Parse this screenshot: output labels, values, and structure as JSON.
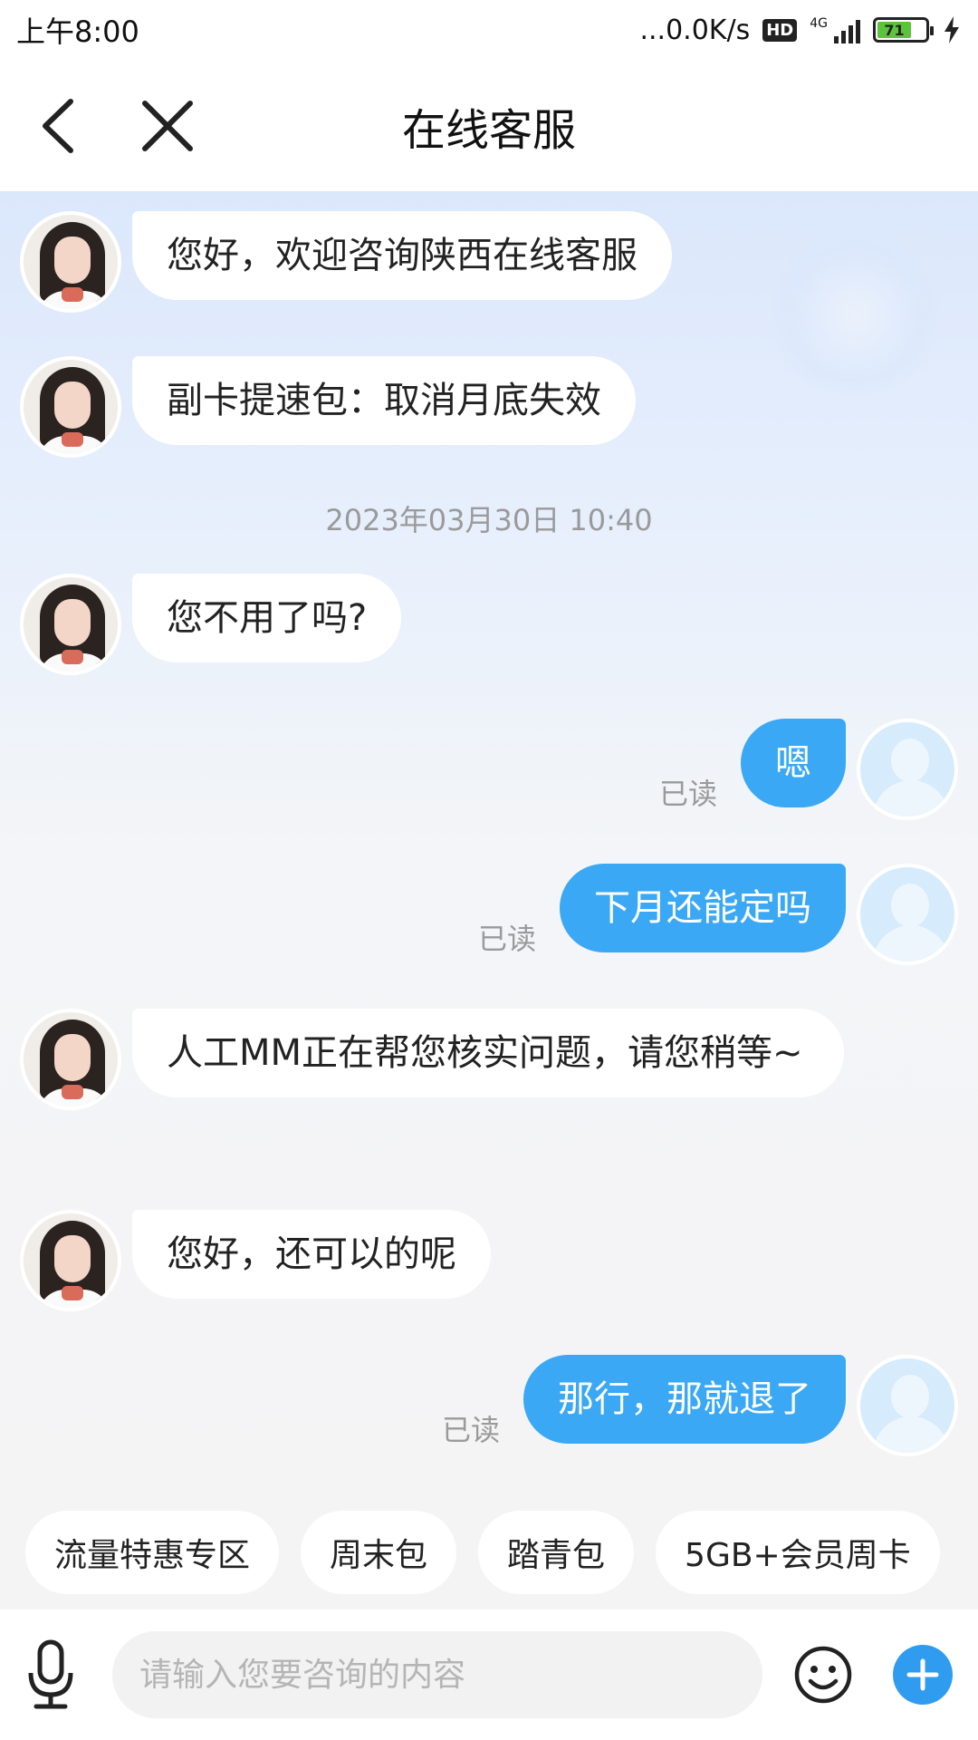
{
  "status_bar": {
    "time": "上午8:00",
    "net_speed": "...0.0K/s",
    "hd": "HD",
    "network": "4G",
    "battery": "71"
  },
  "nav": {
    "back_icon": "chevron-left-icon",
    "close_icon": "close-icon",
    "title": "在线客服"
  },
  "messages": [
    {
      "from": "agent",
      "text": "您好，欢迎咨询陕西在线客服"
    },
    {
      "from": "agent",
      "text": "副卡提速包：取消月底失效"
    },
    {
      "from": "agent",
      "text": "您不用了吗?"
    },
    {
      "from": "user",
      "text": "嗯",
      "read": "已读"
    },
    {
      "from": "user",
      "text": "下月还能定吗",
      "read": "已读"
    },
    {
      "from": "agent",
      "text": "人工MM正在帮您核实问题，请您稍等~"
    },
    {
      "from": "agent",
      "text": "您好，还可以的呢"
    },
    {
      "from": "user",
      "text": "那行，那就退了",
      "read": "已读"
    }
  ],
  "timestamp": "2023年03月30日 10:40",
  "quick_replies": [
    "流量特惠专区",
    "周末包",
    "踏青包",
    "5GB+会员周卡"
  ],
  "input": {
    "placeholder": "请输入您要咨询的内容",
    "mic_icon": "microphone-icon",
    "emoji_icon": "emoji-icon",
    "plus_icon": "plus-icon"
  },
  "colors": {
    "user_bubble": "#3aa8f5",
    "agent_bubble": "#ffffff",
    "plus_button": "#2f9cf0",
    "read_text": "#9a9a9a"
  }
}
